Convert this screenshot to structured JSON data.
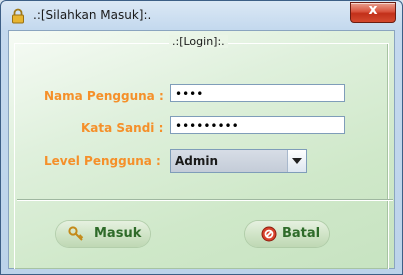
{
  "window": {
    "title": ".:[Silahkan Masuk]:.",
    "close_glyph": "x"
  },
  "form": {
    "legend": ".:[Login]:.",
    "username_label": "Nama Pengguna :",
    "username_value": "••••",
    "password_label": "Kata Sandi :",
    "password_value": "•••••••••",
    "level_label": "Level Pengguna :",
    "level_value": "Admin"
  },
  "buttons": {
    "login_label": "Masuk",
    "cancel_label": "Batal"
  },
  "colors": {
    "label_orange": "#f5902a",
    "button_text_green": "#2f6b2a",
    "close_red": "#c2301a"
  },
  "icons": {
    "title": "lock-icon",
    "login": "key-icon",
    "cancel": "stop-icon"
  }
}
